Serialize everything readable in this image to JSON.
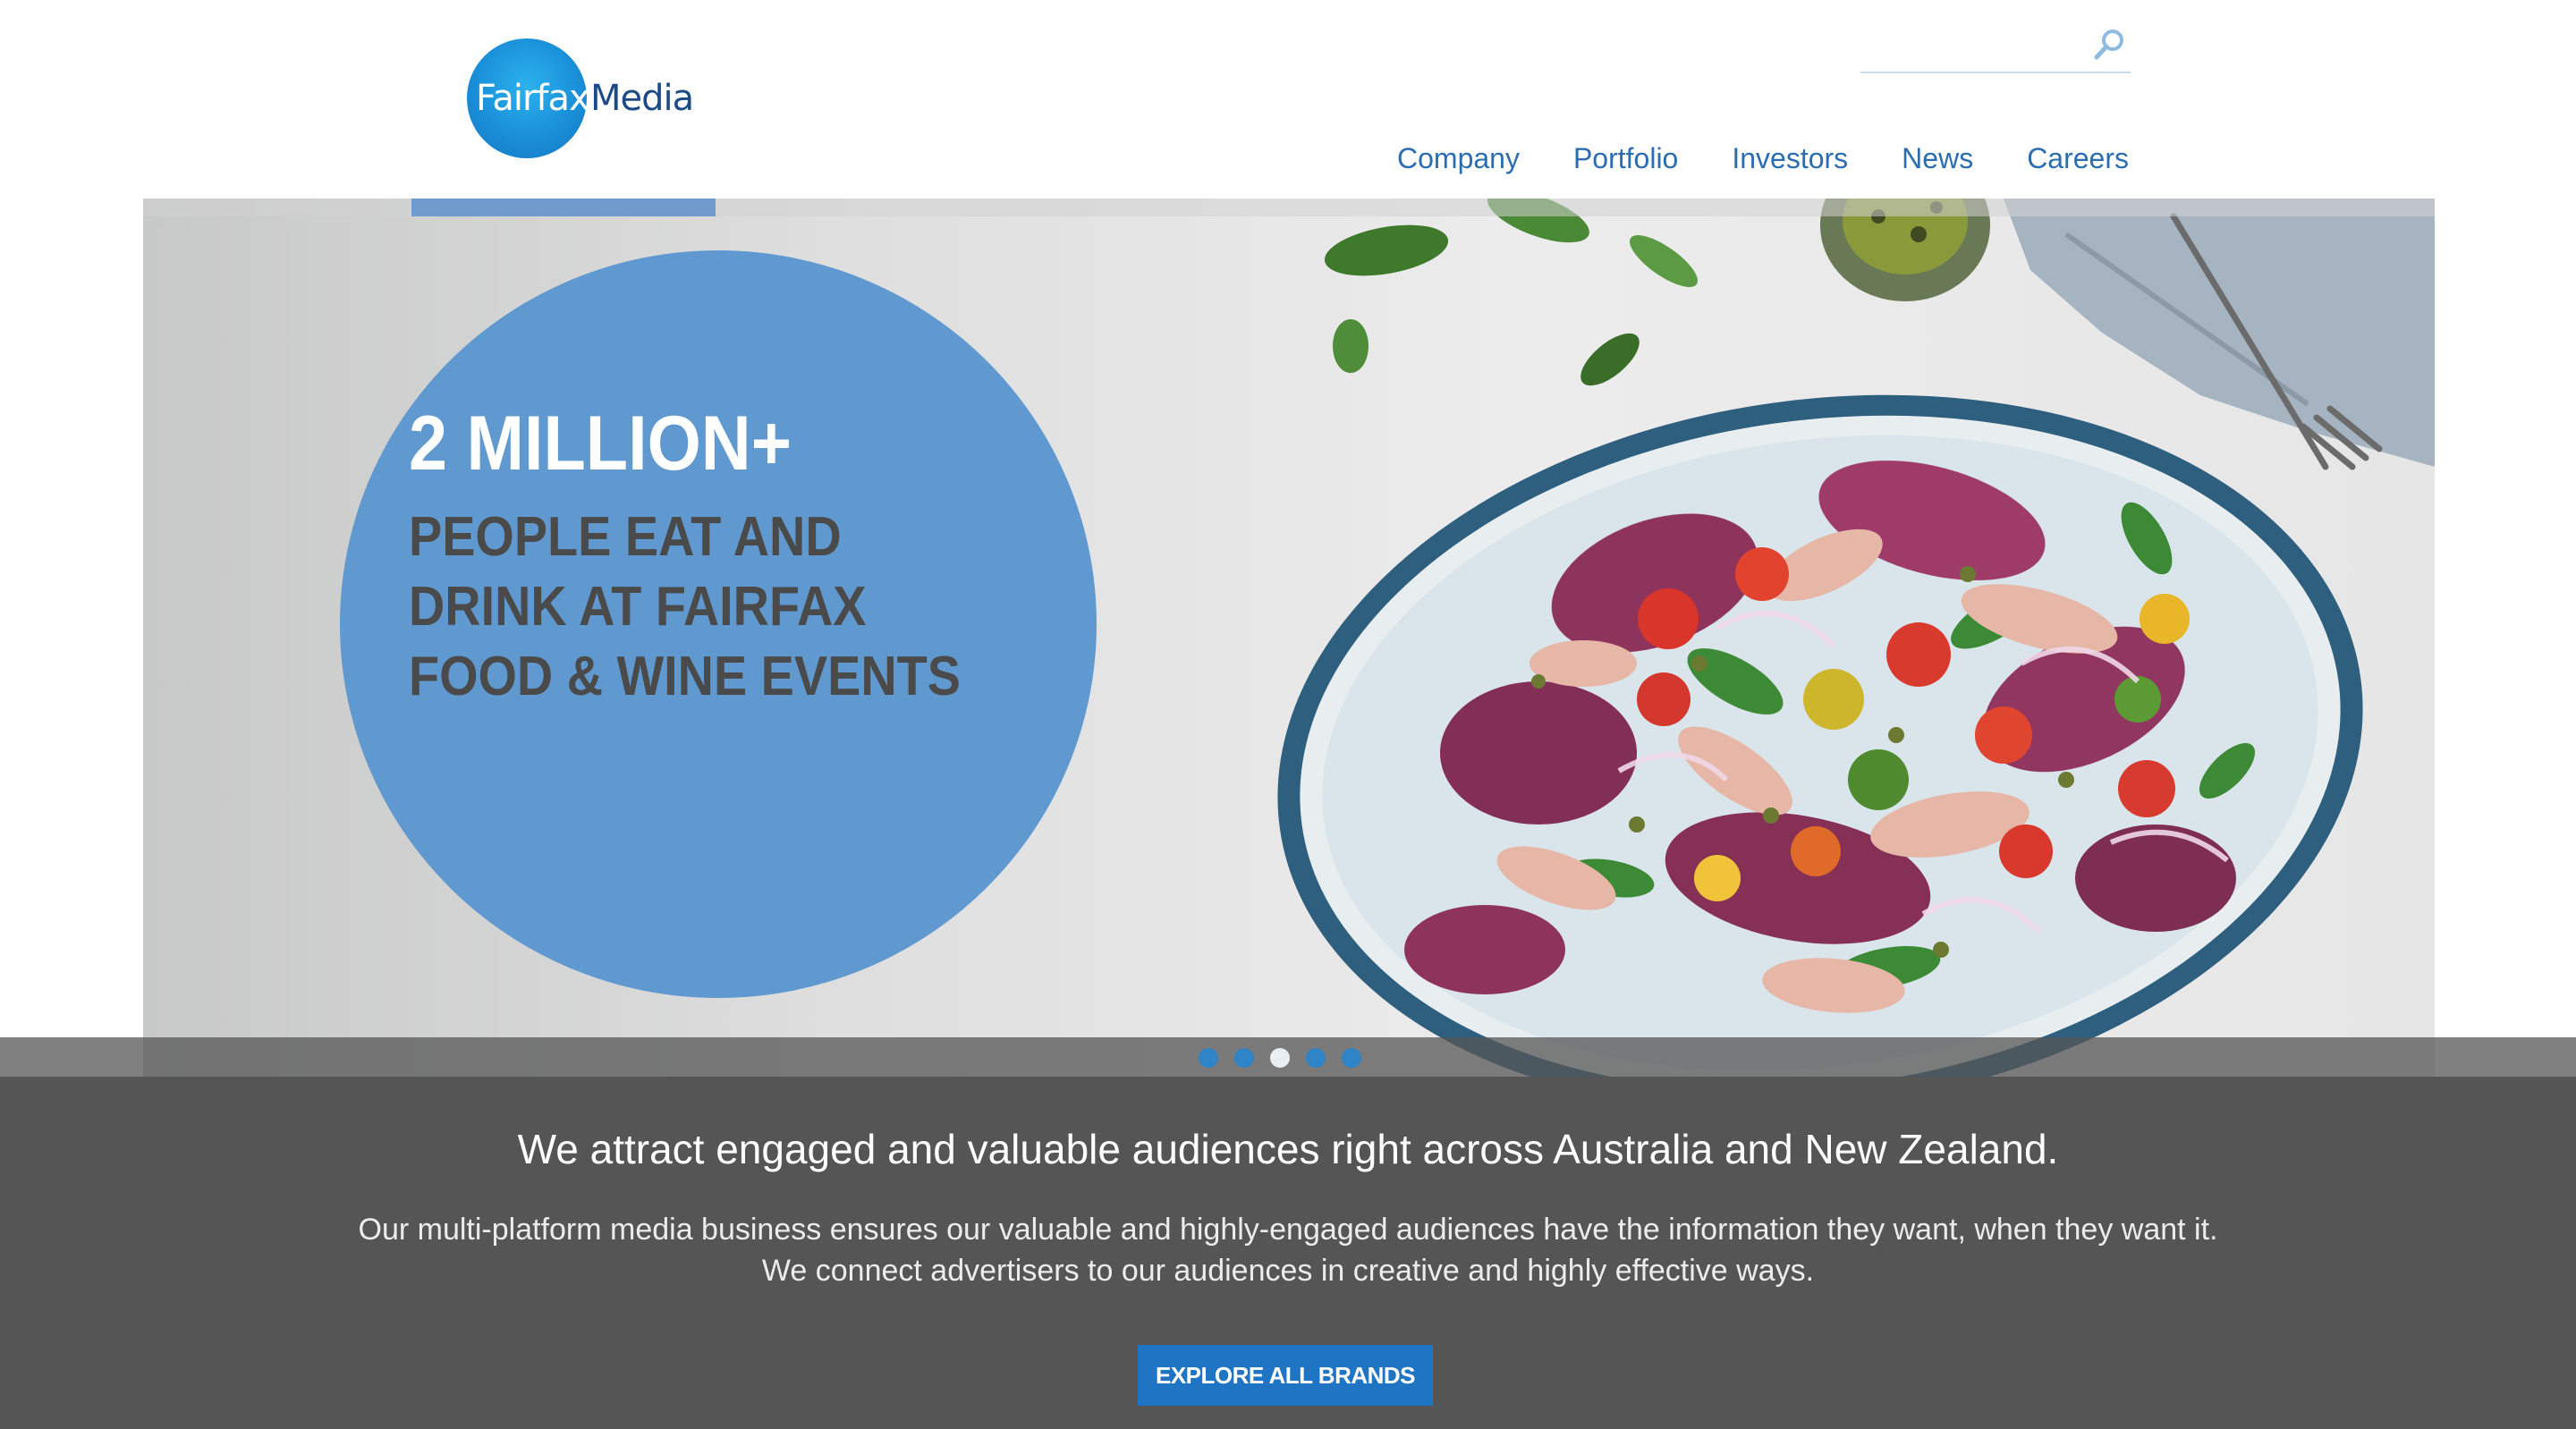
{
  "header": {
    "logo": {
      "word1": "Fairfax",
      "word2": "Media"
    },
    "search": {
      "value": "",
      "placeholder": ""
    },
    "nav": [
      {
        "label": "Company"
      },
      {
        "label": "Portfolio"
      },
      {
        "label": "Investors"
      },
      {
        "label": "News"
      },
      {
        "label": "Careers"
      }
    ]
  },
  "hero": {
    "stat_big": "2 MILLION+",
    "stat_text": "PEOPLE EAT AND DRINK AT FAIRFAX FOOD & WINE EVENTS",
    "image": "salad-platter",
    "slides": {
      "count": 5,
      "active_index": 3
    }
  },
  "lower": {
    "headline": "We attract engaged and valuable audiences right across Australia and New Zealand.",
    "body_line1": "Our multi-platform media business ensures our valuable and highly-engaged audiences have the information they want, when they want it.",
    "body_line2": "We connect advertisers to our audiences in creative and highly effective ways.",
    "cta_label": "EXPLORE ALL BRANDS"
  },
  "colors": {
    "brand_blue": "#2a6db0",
    "circle_blue": "#6099d0",
    "cta_blue": "#1f74c4",
    "lower_bg": "#555555",
    "active_dot": "#e9eef2",
    "inactive_dot": "#2e84c6"
  },
  "icons": {
    "search": "search-icon",
    "slide_dot": "carousel-dot-icon"
  }
}
